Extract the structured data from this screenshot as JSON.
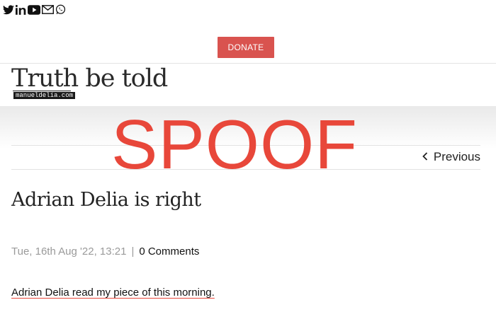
{
  "header": {
    "social_icons": [
      "twitter-icon",
      "linkedin-icon",
      "youtube-icon",
      "email-icon",
      "whatsapp-icon"
    ],
    "donate_label": "DONATE"
  },
  "site": {
    "title": "Truth be told",
    "badge": "manueldelia.com"
  },
  "overlay": {
    "text": "SPOOF",
    "color": "#e8473a"
  },
  "nav": {
    "previous_label": "Previous"
  },
  "post": {
    "title": "Adrian Delia is right",
    "date": "Tue, 16th Aug '22, 13:21",
    "separator": "|",
    "comments": "0 Comments",
    "first_line": "Adrian Delia read my piece of this morning."
  },
  "colors": {
    "accent": "#d9534f",
    "text": "#222222",
    "meta": "#9a9a9a"
  }
}
